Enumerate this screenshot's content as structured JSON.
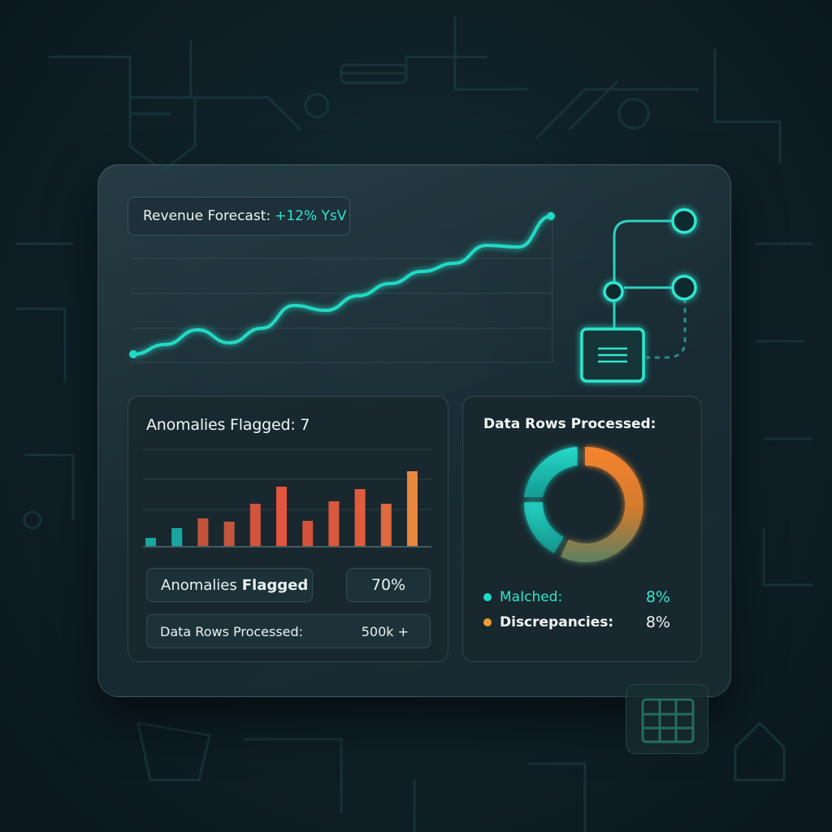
{
  "revenue": {
    "label": "Revenue Forecast:",
    "change": "+12% YsV",
    "line_color": "#22d9c4",
    "trend_points": [
      8,
      20,
      38,
      22,
      40,
      68,
      62,
      80,
      95,
      110,
      120,
      142,
      140,
      178
    ]
  },
  "anomalies": {
    "title": "Anomalies Flagged: 7",
    "bar_values": [
      10,
      22,
      34,
      30,
      52,
      73,
      31,
      55,
      70,
      52,
      92
    ],
    "bar_colors": [
      "#1aa6a0",
      "#1aa6a0",
      "#c2533a",
      "#c4563c",
      "#d3543d",
      "#e2553f",
      "#d4533c",
      "#d9583e",
      "#e05c3f",
      "#df6a40",
      "#e9873f"
    ],
    "stat_label_prefix": "Anomalies",
    "stat_label_strong": "Flagged",
    "stat_value": "70%",
    "rows_label": "Data Rows Processed:",
    "rows_value": "500k +"
  },
  "rows_card": {
    "title": "Data Rows Processed:",
    "matched_label": "MaIched:",
    "matched_value": "8%",
    "discrepancies_label": "Discrepancies:",
    "discrepancies_value": "8%",
    "matched_color": "#21d9c7",
    "discrepancies_color": "#f09a3b"
  },
  "icons": [
    "flow-node-icon",
    "document-icon",
    "table-grid-icon"
  ]
}
